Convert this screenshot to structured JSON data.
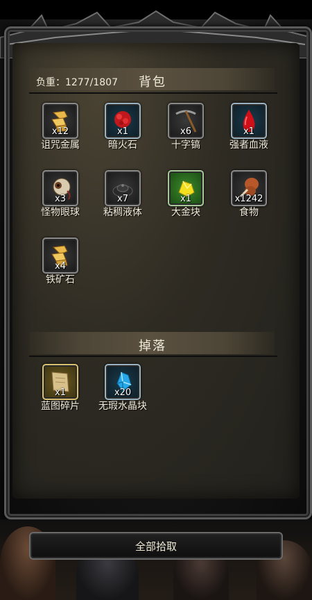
{
  "backpack": {
    "weight_label": "负重：1277/1807",
    "title": "背包",
    "items": [
      {
        "name": "诅咒金属",
        "count": "x12",
        "icon": "cursed-metal-icon",
        "slot": "gray"
      },
      {
        "name": "暗火石",
        "count": "x1",
        "icon": "dark-firestone-icon",
        "slot": "blue"
      },
      {
        "name": "十字镐",
        "count": "x6",
        "icon": "pickaxe-icon",
        "slot": "gray"
      },
      {
        "name": "强者血液",
        "count": "x1",
        "icon": "blood-drop-icon",
        "slot": "blue"
      },
      {
        "name": "怪物眼球",
        "count": "x3",
        "icon": "eyeball-icon",
        "slot": "gray"
      },
      {
        "name": "粘稠液体",
        "count": "x7",
        "icon": "slime-icon",
        "slot": "gray"
      },
      {
        "name": "大金块",
        "count": "x1",
        "icon": "gold-nugget-icon",
        "slot": "green"
      },
      {
        "name": "食物",
        "count": "x1242",
        "icon": "meat-icon",
        "slot": "gray"
      },
      {
        "name": "铁矿石",
        "count": "x4",
        "icon": "iron-ore-icon",
        "slot": "gray"
      }
    ]
  },
  "drops": {
    "title": "掉落",
    "items": [
      {
        "name": "蓝图碎片",
        "count": "x1",
        "icon": "blueprint-scroll-icon",
        "slot": "gold"
      },
      {
        "name": "无瑕水晶块",
        "count": "x20",
        "icon": "blue-crystal-icon",
        "slot": "blue"
      }
    ]
  },
  "actions": {
    "pickup_all_label": "全部拾取"
  }
}
